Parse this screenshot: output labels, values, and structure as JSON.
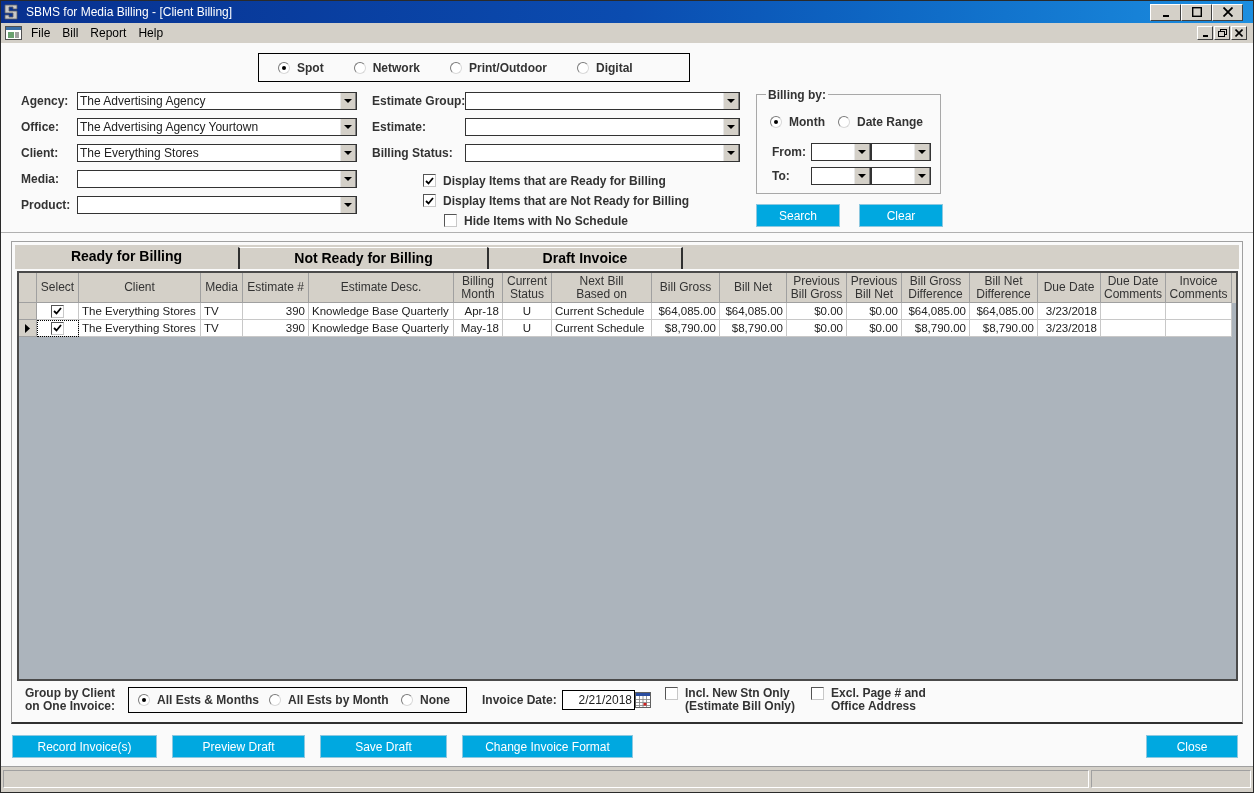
{
  "window": {
    "title": "SBMS for Media Billing - [Client Billing]"
  },
  "menu": [
    {
      "label": "File"
    },
    {
      "label": "Bill"
    },
    {
      "label": "Report"
    },
    {
      "label": "Help"
    }
  ],
  "media_types": [
    {
      "label": "Spot",
      "selected": true
    },
    {
      "label": "Network",
      "selected": false
    },
    {
      "label": "Print/Outdoor",
      "selected": false
    },
    {
      "label": "Digital",
      "selected": false
    }
  ],
  "filters": [
    {
      "label": "Agency:",
      "value": "The Advertising Agency"
    },
    {
      "label": "Office:",
      "value": "The Advertising Agency Yourtown"
    },
    {
      "label": "Client:",
      "value": "The Everything Stores"
    },
    {
      "label": "Media:"
    },
    {
      "label": "Product:"
    }
  ],
  "estimate_filters": [
    {
      "label": "Estimate Group:"
    },
    {
      "label": "Estimate:"
    },
    {
      "label": "Billing Status:"
    }
  ],
  "display_options": [
    {
      "label": "Display Items that are Ready for Billing",
      "checked": true
    },
    {
      "label": "Display Items that are Not Ready for Billing",
      "checked": true,
      "children": [
        {
          "label": "Hide Items with No Schedule",
          "checked": false
        }
      ]
    }
  ],
  "billing_by": {
    "title": "Billing by:",
    "options": [
      {
        "label": "Month",
        "selected": true
      },
      {
        "label": "Date Range",
        "selected": false
      }
    ],
    "ranges": [
      {
        "label": "From:"
      },
      {
        "label": "To:"
      }
    ]
  },
  "search_buttons": [
    {
      "label": "Search"
    },
    {
      "label": "Clear"
    }
  ],
  "tabs": [
    {
      "label": "Ready for Billing",
      "selected": true
    },
    {
      "label": "Not Ready for Billing",
      "selected": false
    },
    {
      "label": "Draft Invoice",
      "selected": false
    }
  ],
  "table": {
    "columns": [
      "Select",
      "Client",
      "Media",
      "Estimate #",
      "Estimate Desc.",
      "Billing\nMonth",
      "Current\nStatus",
      "Next Bill\nBased on",
      "Bill Gross",
      "Bill Net",
      "Previous\nBill Gross",
      "Previous\nBill Net",
      "Bill Gross\nDifference",
      "Bill Net\nDifference",
      "Due Date",
      "Due Date\nComments",
      "Invoice\nComments"
    ],
    "rows": [
      {
        "current": false,
        "checked": true,
        "cells": [
          "",
          "The Everything Stores",
          "TV",
          "390",
          "Knowledge Base Quarterly",
          "Apr-18",
          "U",
          "Current Schedule",
          "$64,085.00",
          "$64,085.00",
          "$0.00",
          "$0.00",
          "$64,085.00",
          "$64,085.00",
          "3/23/2018",
          "",
          ""
        ]
      },
      {
        "current": true,
        "checked": true,
        "cells": [
          "",
          "The Everything Stores",
          "TV",
          "390",
          "Knowledge Base Quarterly",
          "May-18",
          "U",
          "Current Schedule",
          "$8,790.00",
          "$8,790.00",
          "$0.00",
          "$0.00",
          "$8,790.00",
          "$8,790.00",
          "3/23/2018",
          "",
          ""
        ]
      }
    ]
  },
  "grouping": {
    "label": "Group by Client\non One Invoice:",
    "options": [
      {
        "label": "All Ests & Months",
        "selected": true
      },
      {
        "label": "All Ests by Month",
        "selected": false
      },
      {
        "label": "None",
        "selected": false
      }
    ]
  },
  "invoice_date": {
    "label": "Invoice Date:",
    "value": "2/21/2018"
  },
  "invoice_options": [
    {
      "label": "Incl. New Stn Only\n(Estimate Bill Only)",
      "checked": false
    },
    {
      "label": "Excl. Page # and\nOffice Address",
      "checked": false
    }
  ],
  "action_buttons": [
    {
      "label": "Record Invoice(s)"
    },
    {
      "label": "Preview Draft"
    },
    {
      "label": "Save Draft"
    },
    {
      "label": "Change Invoice Format"
    }
  ],
  "close_button": {
    "label": "Close"
  }
}
